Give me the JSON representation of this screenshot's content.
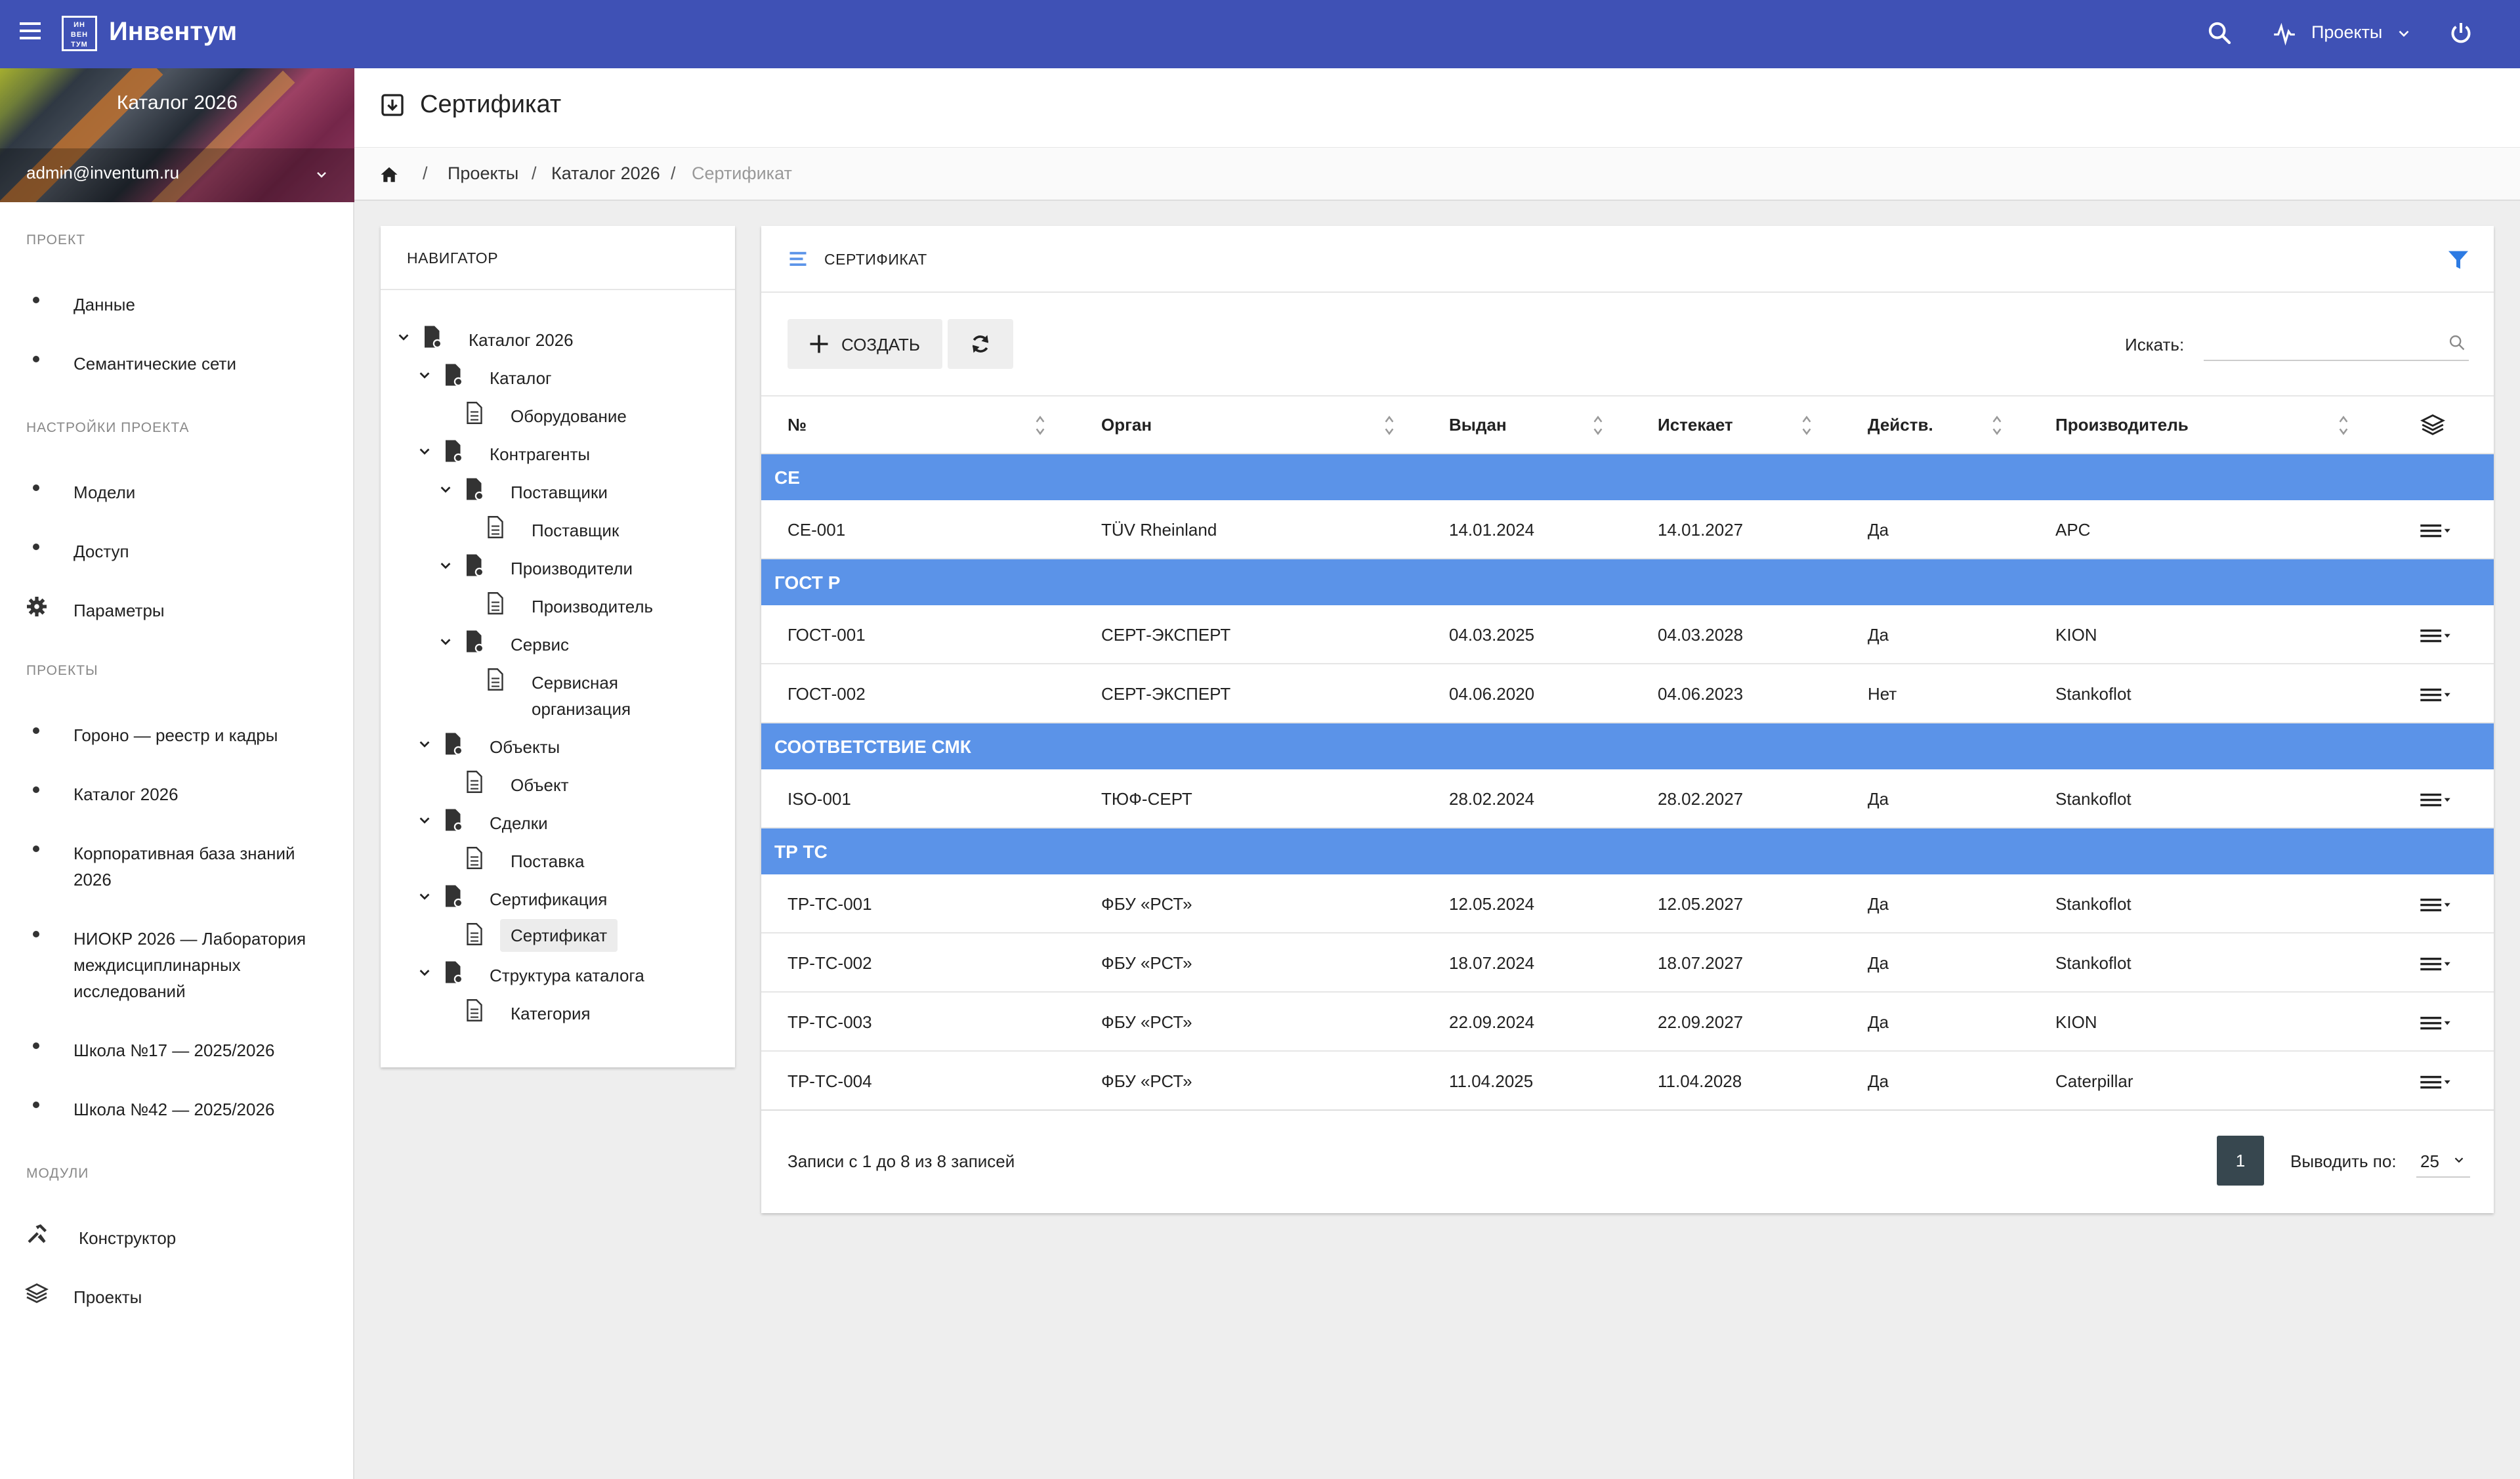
{
  "app": {
    "brand": "Инвентум",
    "logo_text": [
      "ИН",
      "ВЕН",
      "ТУМ"
    ],
    "projects_menu": "Проекты",
    "accent": "#3f51b5"
  },
  "sidebar": {
    "banner_title": "Каталог 2026",
    "user_email": "admin@inventum.ru",
    "sections": {
      "project": "ПРОЕКТ",
      "settings": "НАСТРОЙКИ ПРОЕКТА",
      "projects": "ПРОЕКТЫ",
      "modules": "МОДУЛИ"
    },
    "project_items": [
      "Данные",
      "Семантические сети"
    ],
    "settings_items": [
      "Модели",
      "Доступ",
      "Параметры"
    ],
    "projects_items": [
      "Гороно — реестр и кадры",
      "Каталог 2026",
      "Корпоративная база знаний 2026",
      "НИОКР 2026 — Лаборатория междисциплинарных исследований",
      "Школа №17 — 2025/2026",
      "Школа №42 — 2025/2026"
    ],
    "modules_items": [
      "Конструктор",
      "Проекты"
    ]
  },
  "page": {
    "title": "Сертификат"
  },
  "breadcrumb": {
    "projects": "Проекты",
    "catalog": "Каталог 2026",
    "current": "Сертификат",
    "sep": "/"
  },
  "navigator": {
    "title": "НАВИГАТОР",
    "nodes": [
      {
        "label": "Каталог 2026",
        "folder": true
      },
      {
        "label": "Каталог",
        "folder": true
      },
      {
        "label": "Оборудование",
        "folder": false
      },
      {
        "label": "Контрагенты",
        "folder": true
      },
      {
        "label": "Поставщики",
        "folder": true
      },
      {
        "label": "Поставщик",
        "folder": false
      },
      {
        "label": "Производители",
        "folder": true
      },
      {
        "label": "Производитель",
        "folder": false
      },
      {
        "label": "Сервис",
        "folder": true
      },
      {
        "label": "Сервисная организация",
        "folder": false
      },
      {
        "label": "Объекты",
        "folder": true
      },
      {
        "label": "Объект",
        "folder": false
      },
      {
        "label": "Сделки",
        "folder": true
      },
      {
        "label": "Поставка",
        "folder": false
      },
      {
        "label": "Сертификация",
        "folder": true
      },
      {
        "label": "Сертификат",
        "folder": false,
        "selected": true
      },
      {
        "label": "Структура каталога",
        "folder": true
      },
      {
        "label": "Категория",
        "folder": false
      }
    ]
  },
  "table": {
    "title": "СЕРТИФИКАТ",
    "create_label": "СОЗДАТЬ",
    "search_label": "Искать:",
    "search_value": "",
    "search_placeholder": "",
    "columns": [
      "№",
      "Орган",
      "Выдан",
      "Истекает",
      "Действ.",
      "Производитель"
    ],
    "group_color": "#5b93e8",
    "groups": [
      {
        "name": "CE",
        "rows": [
          [
            "CE-001",
            "TÜV Rheinland",
            "14.01.2024",
            "14.01.2027",
            "Да",
            "APC"
          ]
        ]
      },
      {
        "name": "ГОСТ Р",
        "rows": [
          [
            "ГОСТ-001",
            "СЕРТ-ЭКСПЕРТ",
            "04.03.2025",
            "04.03.2028",
            "Да",
            "KION"
          ],
          [
            "ГОСТ-002",
            "СЕРТ-ЭКСПЕРТ",
            "04.06.2020",
            "04.06.2023",
            "Нет",
            "Stankoflot"
          ]
        ]
      },
      {
        "name": "СООТВЕТСТВИЕ СМК",
        "rows": [
          [
            "ISO-001",
            "ТЮФ-СЕРТ",
            "28.02.2024",
            "28.02.2027",
            "Да",
            "Stankoflot"
          ]
        ]
      },
      {
        "name": "ТР ТС",
        "rows": [
          [
            "ТР-ТС-001",
            "ФБУ «РСТ»",
            "12.05.2024",
            "12.05.2027",
            "Да",
            "Stankoflot"
          ],
          [
            "ТР-ТС-002",
            "ФБУ «РСТ»",
            "18.07.2024",
            "18.07.2027",
            "Да",
            "Stankoflot"
          ],
          [
            "ТР-ТС-003",
            "ФБУ «РСТ»",
            "22.09.2024",
            "22.09.2027",
            "Да",
            "KION"
          ],
          [
            "ТР-ТС-004",
            "ФБУ «РСТ»",
            "11.04.2025",
            "11.04.2028",
            "Да",
            "Caterpillar"
          ]
        ]
      }
    ],
    "footer_info": "Записи с 1 до 8 из 8 записей",
    "current_page": "1",
    "per_page_label": "Выводить по:",
    "per_page": "25"
  }
}
